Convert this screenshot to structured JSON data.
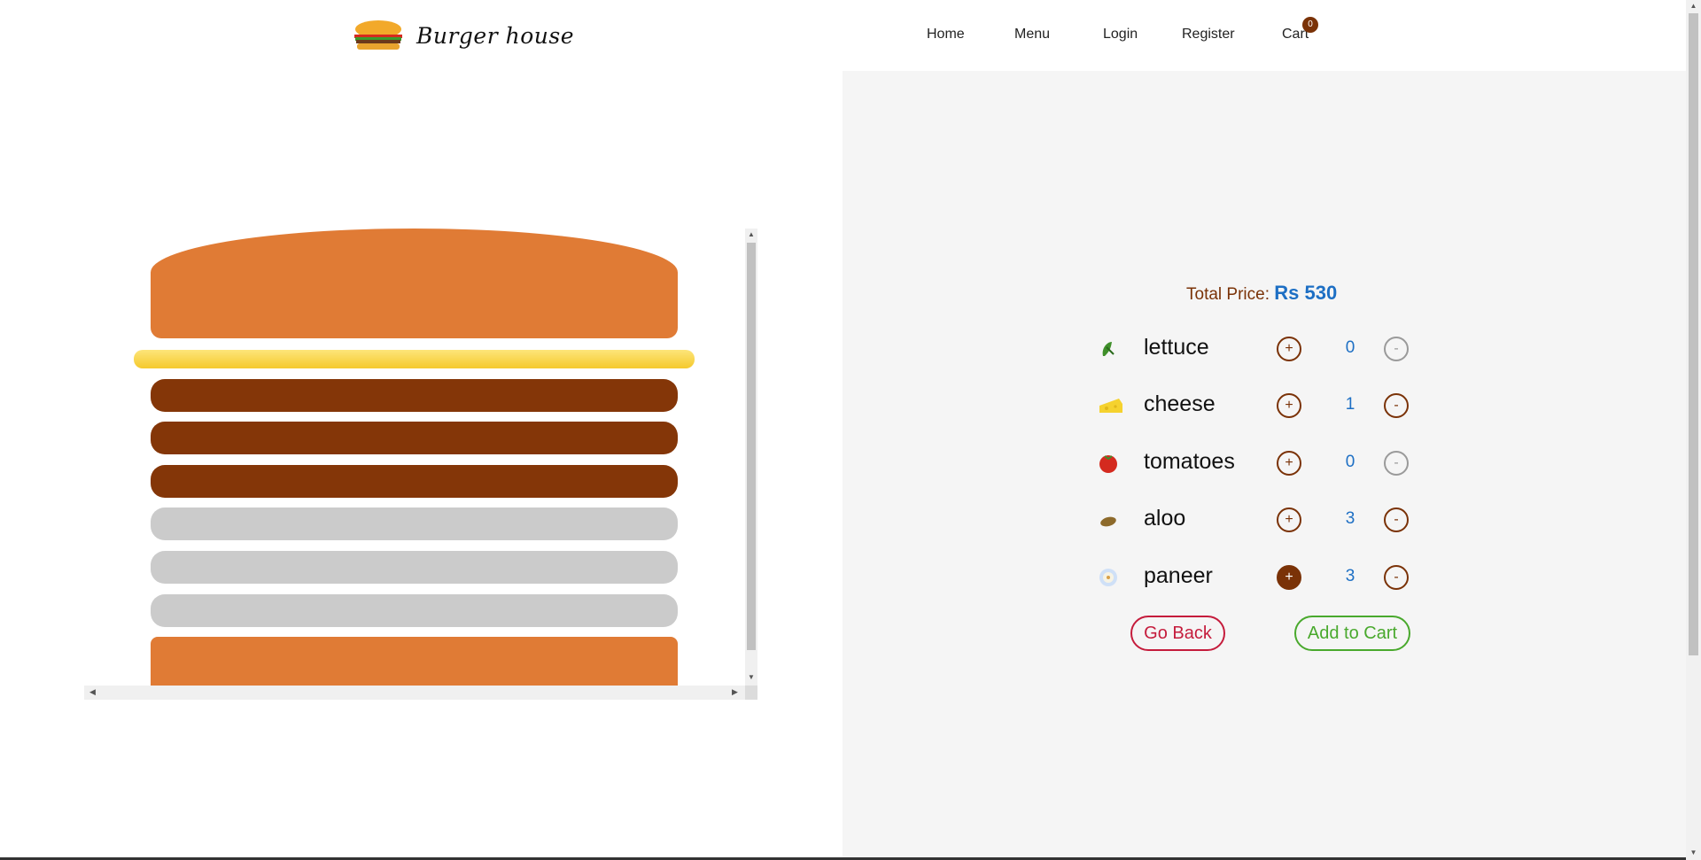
{
  "brand": {
    "name": "Burger house",
    "logo_icon": "burger-icon"
  },
  "nav": {
    "items": [
      "Home",
      "Menu",
      "Login",
      "Register",
      "Cart"
    ],
    "cart_count": "0"
  },
  "burger": {
    "layers": [
      "bun-top",
      "cheese",
      "patty",
      "patty",
      "patty",
      "aloo",
      "aloo",
      "aloo",
      "bun-bottom"
    ]
  },
  "order": {
    "total_label": "Total Price:",
    "total_value": "Rs 530",
    "ingredients": [
      {
        "name": "lettuce",
        "qty": "0",
        "icon": "lettuce-icon",
        "add": "+",
        "remove": "-"
      },
      {
        "name": "cheese",
        "qty": "1",
        "icon": "cheese-icon",
        "add": "+",
        "remove": "-"
      },
      {
        "name": "tomatoes",
        "qty": "0",
        "icon": "tomato-icon",
        "add": "+",
        "remove": "-"
      },
      {
        "name": "aloo",
        "qty": "3",
        "icon": "potato-icon",
        "add": "+",
        "remove": "-"
      },
      {
        "name": "paneer",
        "qty": "3",
        "icon": "paneer-icon",
        "add": "+",
        "remove": "-"
      }
    ],
    "go_back": "Go Back",
    "add_to_cart": "Add to Cart"
  },
  "colors": {
    "accent": "#7a3207",
    "price": "#1d6fc4",
    "bun": "#e07b35",
    "patty": "#843608",
    "aloo": "#cbcbcb",
    "go_back": "#c51c3c",
    "add_to_cart": "#49a92d"
  }
}
